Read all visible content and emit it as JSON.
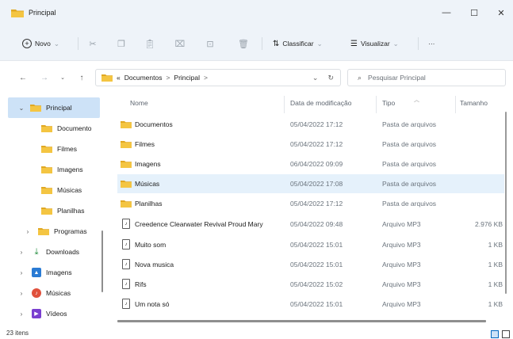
{
  "window": {
    "title": "Principal",
    "minimize_glyph": "—",
    "maximize_glyph": "☐",
    "close_glyph": "✕"
  },
  "toolbar": {
    "new_label": "Novo",
    "sort_label": "Classificar",
    "view_label": "Visualizar",
    "more_label": "···"
  },
  "address": {
    "prefix": "«",
    "crumb_1": "Documentos",
    "sep": ">",
    "crumb_2": "Principal",
    "search_placeholder": "Pesquisar Principal"
  },
  "sidebar": {
    "items": [
      {
        "label": "Principal",
        "icon": "folder-icon",
        "expanded": true,
        "selected": true
      },
      {
        "label": "Documento",
        "icon": "folder-icon"
      },
      {
        "label": "Filmes",
        "icon": "folder-icon"
      },
      {
        "label": "Imagens",
        "icon": "folder-icon"
      },
      {
        "label": "Músicas",
        "icon": "folder-icon"
      },
      {
        "label": "Planilhas",
        "icon": "folder-icon"
      },
      {
        "label": "Programas",
        "icon": "folder-icon"
      },
      {
        "label": "Downloads",
        "icon": "download-icon"
      },
      {
        "label": "Imagens",
        "icon": "pictures-icon"
      },
      {
        "label": "Músicas",
        "icon": "music-icon"
      },
      {
        "label": "Vídeos",
        "icon": "videos-icon"
      }
    ]
  },
  "columns": {
    "name": "Nome",
    "date": "Data de modificação",
    "type": "Tipo",
    "size": "Tamanho"
  },
  "files": [
    {
      "name": "Documentos",
      "date": "05/04/2022 17:12",
      "type": "Pasta de arquivos",
      "size": "",
      "kind": "folder"
    },
    {
      "name": "Filmes",
      "date": "05/04/2022 17:12",
      "type": "Pasta de arquivos",
      "size": "",
      "kind": "folder"
    },
    {
      "name": "Imagens",
      "date": "06/04/2022 09:09",
      "type": "Pasta de arquivos",
      "size": "",
      "kind": "folder"
    },
    {
      "name": "Músicas",
      "date": "05/04/2022 17:08",
      "type": "Pasta de arquivos",
      "size": "",
      "kind": "folder",
      "selected": true
    },
    {
      "name": "Planilhas",
      "date": "05/04/2022 17:12",
      "type": "Pasta de arquivos",
      "size": "",
      "kind": "folder"
    },
    {
      "name": "Creedence Clearwater Revival Proud Mary",
      "date": "05/04/2022 09:48",
      "type": "Arquivo MP3",
      "size": "2.976 KB",
      "kind": "mp3"
    },
    {
      "name": "Muito som",
      "date": "05/04/2022 15:01",
      "type": "Arquivo MP3",
      "size": "1 KB",
      "kind": "mp3"
    },
    {
      "name": "Nova musica",
      "date": "05/04/2022 15:01",
      "type": "Arquivo MP3",
      "size": "1 KB",
      "kind": "mp3"
    },
    {
      "name": "Rifs",
      "date": "05/04/2022 15:02",
      "type": "Arquivo MP3",
      "size": "1 KB",
      "kind": "mp3"
    },
    {
      "name": "Um nota só",
      "date": "05/04/2022 15:01",
      "type": "Arquivo MP3",
      "size": "1 KB",
      "kind": "mp3"
    }
  ],
  "status": {
    "count": "23 itens"
  },
  "colors": {
    "folder": "#f4c542",
    "folder_dark": "#e0a823",
    "selection": "#cde2f7",
    "row_selection": "#e5f1fb",
    "chrome": "#eef3f9",
    "accent": "#0067c0"
  }
}
